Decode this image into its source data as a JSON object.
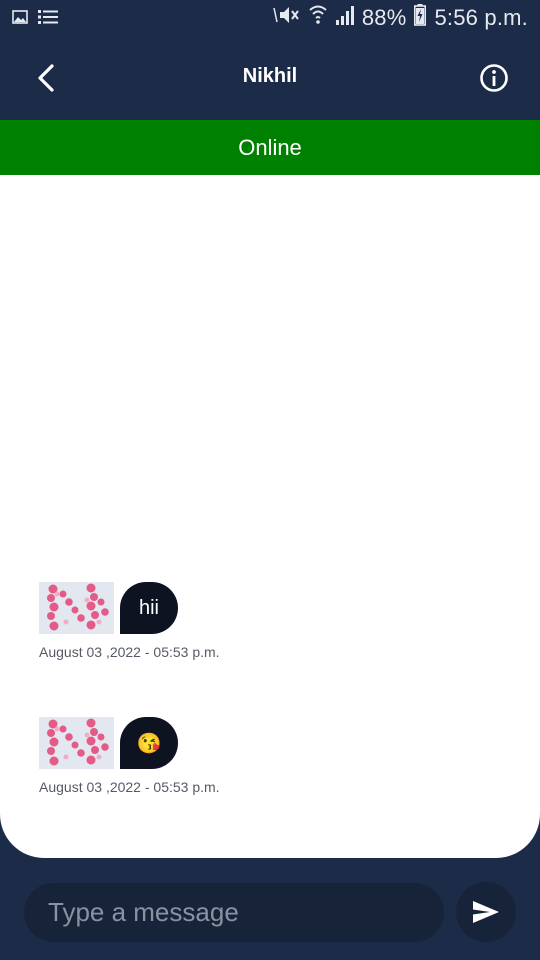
{
  "status_bar": {
    "battery": "88%",
    "time": "5:56 p.m.",
    "icons": [
      "image-icon",
      "list-icon",
      "mute-icon",
      "wifi-icon",
      "signal-icon",
      "battery-charging-icon"
    ]
  },
  "header": {
    "title": "Nikhil",
    "back_icon": "chevron-left-icon",
    "info_icon": "info-icon"
  },
  "presence": {
    "label": "Online",
    "color": "#008000"
  },
  "messages": [
    {
      "text": "hii",
      "timestamp": "August 03 ,2022 - 05:53 p.m."
    },
    {
      "text": "😘",
      "timestamp": "August 03 ,2022 - 05:53 p.m."
    }
  ],
  "composer": {
    "placeholder": "Type a message",
    "send_icon": "send-icon"
  },
  "colors": {
    "background": "#1c2b48",
    "bubble": "#0d1320",
    "online": "#008000"
  }
}
